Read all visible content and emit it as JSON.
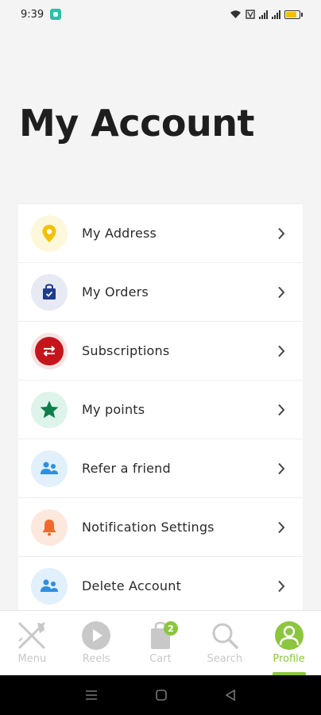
{
  "status": {
    "time": "9:39"
  },
  "page": {
    "title": "My Account"
  },
  "menu": {
    "items": [
      {
        "label": "My Address",
        "icon": "location-pin-icon",
        "color": "#f2c200",
        "bg": "#fdf7dc"
      },
      {
        "label": "My Orders",
        "icon": "shopping-bag-icon",
        "color": "#1f3b8f",
        "bg": "#e7e9f3"
      },
      {
        "label": "Subscriptions",
        "icon": "repeat-icon",
        "color": "#c4151c",
        "bg": "#f8e1e1"
      },
      {
        "label": "My points",
        "icon": "star-icon",
        "color": "#0e7d4a",
        "bg": "#def4ea"
      },
      {
        "label": "Refer a friend",
        "icon": "users-icon",
        "color": "#2d8fe0",
        "bg": "#e1f0fb"
      },
      {
        "label": "Notification Settings",
        "icon": "bell-icon",
        "color": "#ee6b2c",
        "bg": "#fde8de"
      },
      {
        "label": "Delete Account",
        "icon": "users-icon",
        "color": "#2d8fe0",
        "bg": "#e1f0fb"
      }
    ]
  },
  "nav": {
    "menu_label": "Menu",
    "reels_label": "Reels",
    "cart_label": "Cart",
    "cart_count": "2",
    "search_label": "Search",
    "profile_label": "Profile",
    "active_color": "#8cc63f",
    "inactive_color": "#c8c8c8"
  }
}
